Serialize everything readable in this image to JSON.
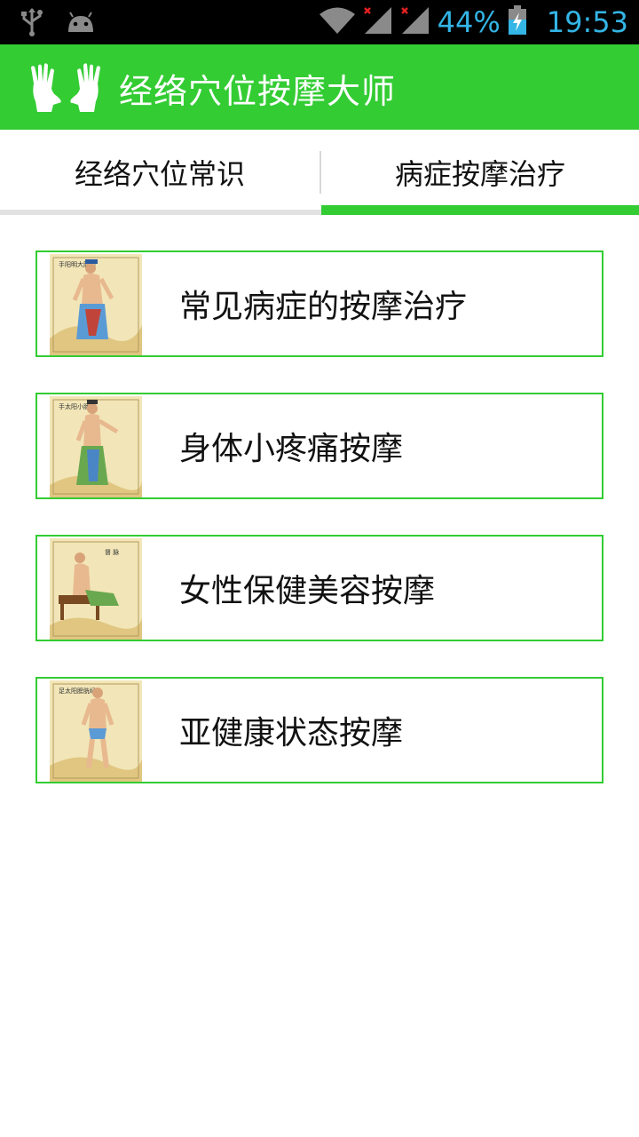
{
  "status_bar": {
    "battery": "44%",
    "time": "19:53",
    "icons": [
      "usb-icon",
      "android-icon",
      "wifi-icon",
      "signal-icon",
      "signal-icon",
      "battery-charging-icon"
    ]
  },
  "app_bar": {
    "title": "经络穴位按摩大师",
    "logo_icon": "hands-icon",
    "background": "#33cc33"
  },
  "tabs": [
    {
      "label": "经络穴位常识",
      "selected": false
    },
    {
      "label": "病症按摩治疗",
      "selected": true
    }
  ],
  "items": [
    {
      "label": "常见病症的按摩治疗",
      "icon": "meridian-figure-illustration"
    },
    {
      "label": "身体小疼痛按摩",
      "icon": "meridian-figure-illustration"
    },
    {
      "label": "女性保健美容按摩",
      "icon": "meridian-figure-illustration"
    },
    {
      "label": "亚健康状态按摩",
      "icon": "meridian-figure-illustration"
    }
  ],
  "colors": {
    "accent": "#33cc33",
    "status_text": "#33b5e5"
  }
}
